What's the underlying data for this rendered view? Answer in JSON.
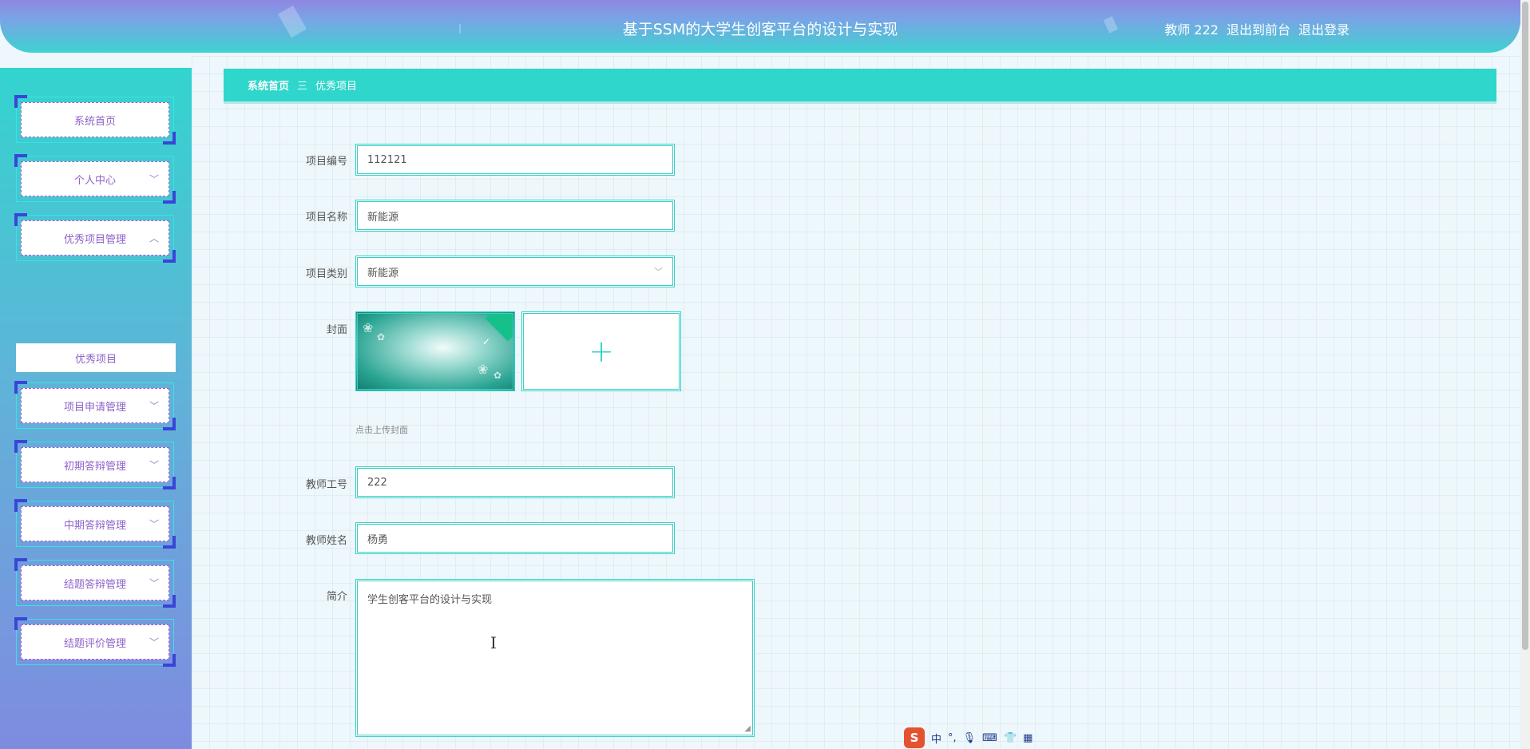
{
  "header": {
    "title": "基于SSM的大学生创客平台的设计与实现",
    "user_label": "教师 222",
    "back_to_front": "退出到前台",
    "logout": "退出登录"
  },
  "sidebar": {
    "items": [
      {
        "label": "系统首页",
        "chevron": ""
      },
      {
        "label": "个人中心",
        "chevron": "﹀"
      },
      {
        "label": "优秀项目管理",
        "chevron": "︿"
      },
      {
        "label": "项目申请管理",
        "chevron": "﹀"
      },
      {
        "label": "初期答辩管理",
        "chevron": "﹀"
      },
      {
        "label": "中期答辩管理",
        "chevron": "﹀"
      },
      {
        "label": "结题答辩管理",
        "chevron": "﹀"
      },
      {
        "label": "结题评价管理",
        "chevron": "﹀"
      }
    ],
    "submenu_active": "优秀项目"
  },
  "breadcrumb": {
    "home": "系统首页",
    "separator": "三",
    "current": "优秀项目"
  },
  "form": {
    "project_no": {
      "label": "项目编号",
      "value": "112121"
    },
    "project_name": {
      "label": "项目名称",
      "value": "新能源"
    },
    "project_category": {
      "label": "项目类别",
      "value": "新能源"
    },
    "cover": {
      "label": "封面",
      "hint": "点击上传封面",
      "upload_plus": "+"
    },
    "teacher_no": {
      "label": "教师工号",
      "value": "222"
    },
    "teacher_name": {
      "label": "教师姓名",
      "value": "杨勇"
    },
    "intro": {
      "label": "简介",
      "value": "学生创客平台的设计与实现"
    }
  },
  "ime": {
    "logo": "S",
    "mode": "中",
    "punct": "°,",
    "icons": [
      "mic-icon",
      "keyboard-icon",
      "shirt-icon",
      "grid-icon"
    ]
  },
  "colors": {
    "accent": "#2fd6cc",
    "menu_text": "#8e63c9",
    "corner": "#3a45d8"
  }
}
